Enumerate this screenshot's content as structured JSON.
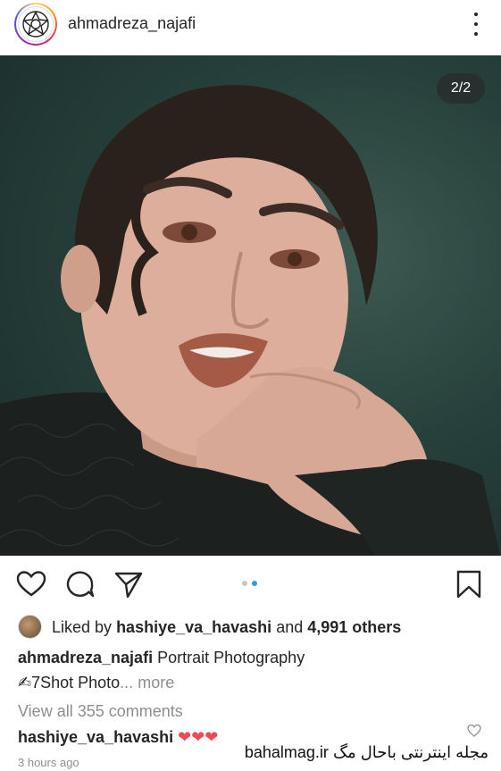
{
  "post": {
    "author": "ahmadreza_najafi",
    "image_counter": "2/2",
    "image_alt": "Portrait of a young woman with short wet curly hair biting her finger, dark green background"
  },
  "likes": {
    "prefix": "Liked by",
    "user": "hashiye_va_havashi",
    "middle": "and",
    "others": "4,991 others"
  },
  "caption": {
    "author": "ahmadreza_najafi",
    "text": "Portrait Photography",
    "line2": "✍7Shot Photo",
    "ellipsis": "...",
    "more": "more"
  },
  "comments": {
    "view_all": "View all 355 comments",
    "first_user": "hashiye_va_havashi",
    "first_text": "❤❤❤"
  },
  "timestamp": "3 hours ago",
  "watermark": "bahalmag.ir مجله اینترنتی باحال مگ",
  "icons": [
    "heart-icon",
    "comment-icon",
    "share-icon",
    "bookmark-icon",
    "more-options-icon",
    "small-like-icon"
  ],
  "colors": {
    "accent": "#3897f0",
    "text": "#262626",
    "muted": "#8e8e8e",
    "heart": "#ed4956"
  }
}
